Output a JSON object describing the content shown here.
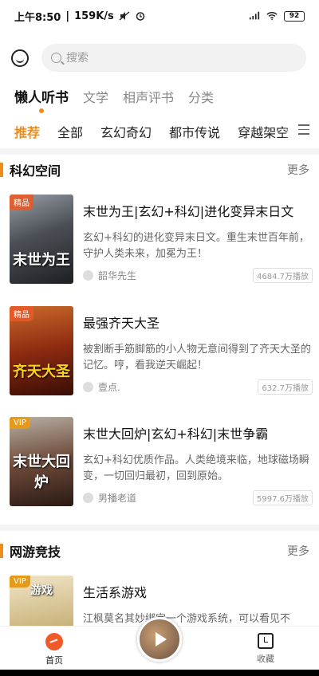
{
  "status_bar": {
    "time": "上午8:50",
    "speed": "159K/s",
    "signal": "4G",
    "battery": "92"
  },
  "search": {
    "placeholder": "搜索"
  },
  "primary_tabs": [
    "懒人听书",
    "文学",
    "相声评书",
    "分类"
  ],
  "secondary_tabs": [
    "推荐",
    "全部",
    "玄幻奇幻",
    "都市传说",
    "穿越架空"
  ],
  "sections": [
    {
      "title": "科幻空间",
      "more": "更多",
      "books": [
        {
          "badge": "精品",
          "cover_text": "末世为王",
          "title": "末世为王|玄幻+科幻|进化变异末日文",
          "desc": "玄幻+科幻的进化变异末日文。重生末世百年前，守护人类未来，加冕为王！",
          "author": "韶华先生",
          "plays": "4684.7万播放"
        },
        {
          "badge": "精品",
          "cover_text": "齐天大圣",
          "title": "最强齐天大圣",
          "desc": "被割断手筋脚筋的小人物无意间得到了齐天大圣的记忆。哼，看我逆天崛起！",
          "author": "壹点.",
          "plays": "632.7万播放"
        },
        {
          "badge": "VIP",
          "cover_text": "末世大回炉",
          "title": "末世大回炉|玄幻+科幻|末世争霸",
          "desc": "玄幻+科幻优质作品。人类绝境来临，地球磁场瞬变，一切回归最初，回到原始。",
          "author": "男播老道",
          "plays": "5997.6万播放"
        }
      ]
    },
    {
      "title": "网游竞技",
      "more": "更多",
      "books": [
        {
          "badge": "VIP",
          "cover_text": "游戏",
          "title": "生活系游戏",
          "desc": "江枫莫名其妙绑定一个游戏系统，可以看见不",
          "author": "",
          "plays": ""
        }
      ]
    }
  ],
  "bottom_nav": {
    "home": "首页",
    "favorites": "收藏"
  },
  "colors": {
    "accent": "#f08c1a",
    "home_icon": "#f05a28"
  }
}
